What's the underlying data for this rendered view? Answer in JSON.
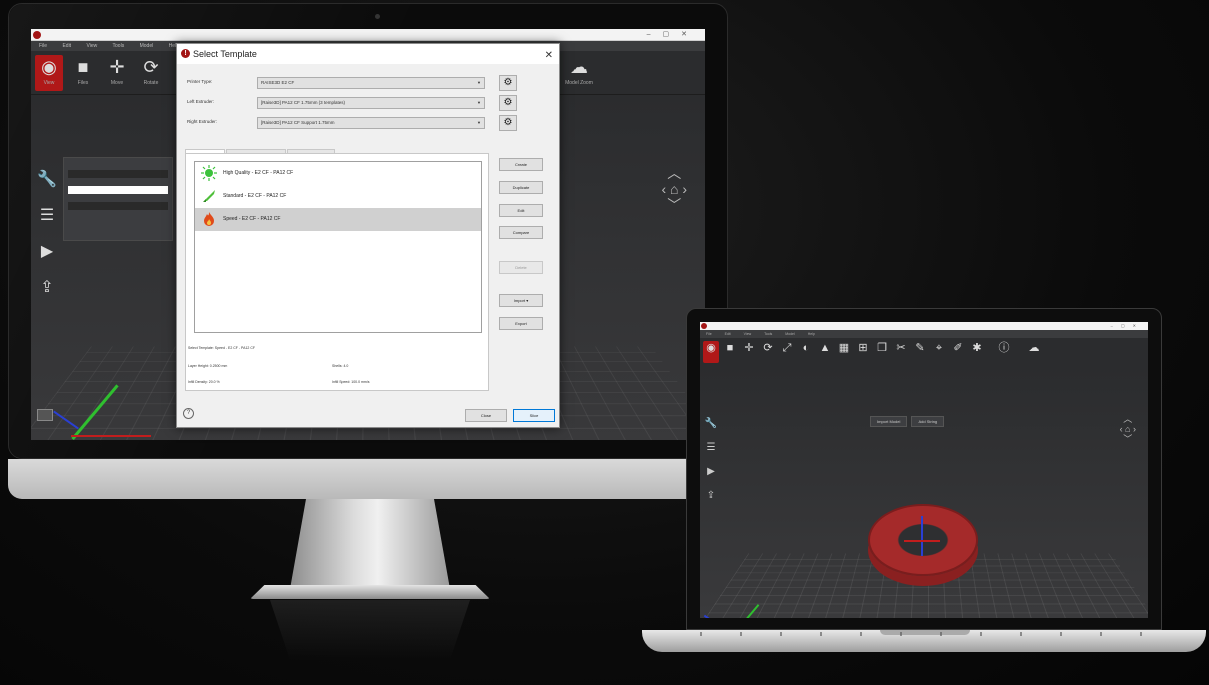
{
  "imac_app": {
    "title": "",
    "menu": [
      "File",
      "Edit",
      "View",
      "Tools",
      "Model",
      "Help"
    ],
    "toolbar": [
      {
        "icon": "eye-icon",
        "label": "View",
        "active": true
      },
      {
        "icon": "cube-icon",
        "label": "Files",
        "active": false
      },
      {
        "icon": "move-icon",
        "label": "Move",
        "active": false
      },
      {
        "icon": "rotate-icon",
        "label": "Rotate",
        "active": false
      }
    ],
    "right_tool": {
      "icon": "cloud-icon",
      "label": "Model Zoom"
    }
  },
  "dialog": {
    "title": "Select Template",
    "printer_type_label": "Printer Type:",
    "printer_type_value": "RAISE3D E2 CF",
    "left_extruder_label": "Left Extruder:",
    "left_extruder_value": "[Raise3D] PA12 CF 1.75mm (3 templates)",
    "right_extruder_label": "Right Extruder:",
    "right_extruder_value": "[Raise3D] PA12 CF Support 1.75mm",
    "tabs": [
      "Main Template",
      "Group and Layer Settings",
      "Per-Model Extruder"
    ],
    "templates": [
      {
        "name": "High Quality - E2 CF - PA12 CF",
        "icon": "high-quality-icon"
      },
      {
        "name": "Standard - E2 CF - PA12 CF",
        "icon": "standard-rocket-icon"
      },
      {
        "name": "Speed - E2 CF - PA12 CF",
        "icon": "speed-flame-icon"
      }
    ],
    "selected_index": 2,
    "selected_label": "Select Template: Speed - E2 CF - PA12 CF",
    "layer_height": "Layer Height: 0.2500 mm",
    "shells": "Shells: 4.0",
    "infill_density": "Infill Density: 20.0 %",
    "infill_speed": "Infill Speed: 100.0 mm/s",
    "side_buttons": [
      "Create",
      "Duplicate",
      "Edit",
      "Compare",
      "Delete",
      "Import",
      "Export"
    ],
    "help": "?",
    "close_label": "Close",
    "ok_label": "Slice"
  },
  "laptop_app": {
    "chips": [
      "Import Model",
      "Add String"
    ],
    "menu": [
      "File",
      "Edit",
      "View",
      "Tools",
      "Model",
      "Help"
    ]
  }
}
